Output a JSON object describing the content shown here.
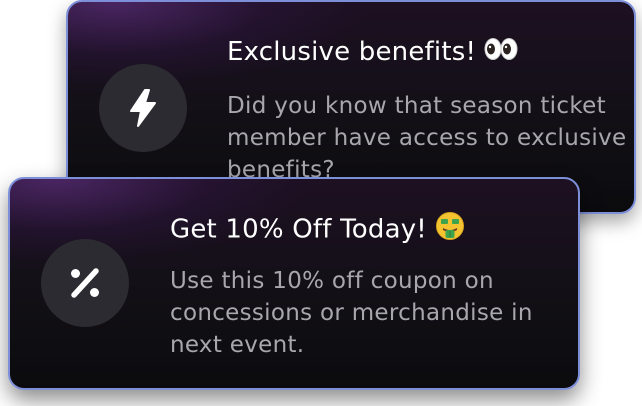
{
  "notifications": [
    {
      "title": "Exclusive benefits!",
      "title_emoji": "eyes-emoji",
      "message": "Did you know that season ticket member have access to exclusive benefits?",
      "icon": "lightning-bolt-icon"
    },
    {
      "title": "Get 10% Off Today!",
      "title_emoji": "money-mouth-face-emoji",
      "message": "Use this 10% off coupon on concessions or merchandise in next event.",
      "icon": "percent-icon"
    }
  ],
  "colors": {
    "card_border": "#7d8fd8",
    "card_background": "#121016",
    "icon_circle": "#2c2b31",
    "title_text": "#ffffff",
    "body_text": "#a9a7ae"
  }
}
